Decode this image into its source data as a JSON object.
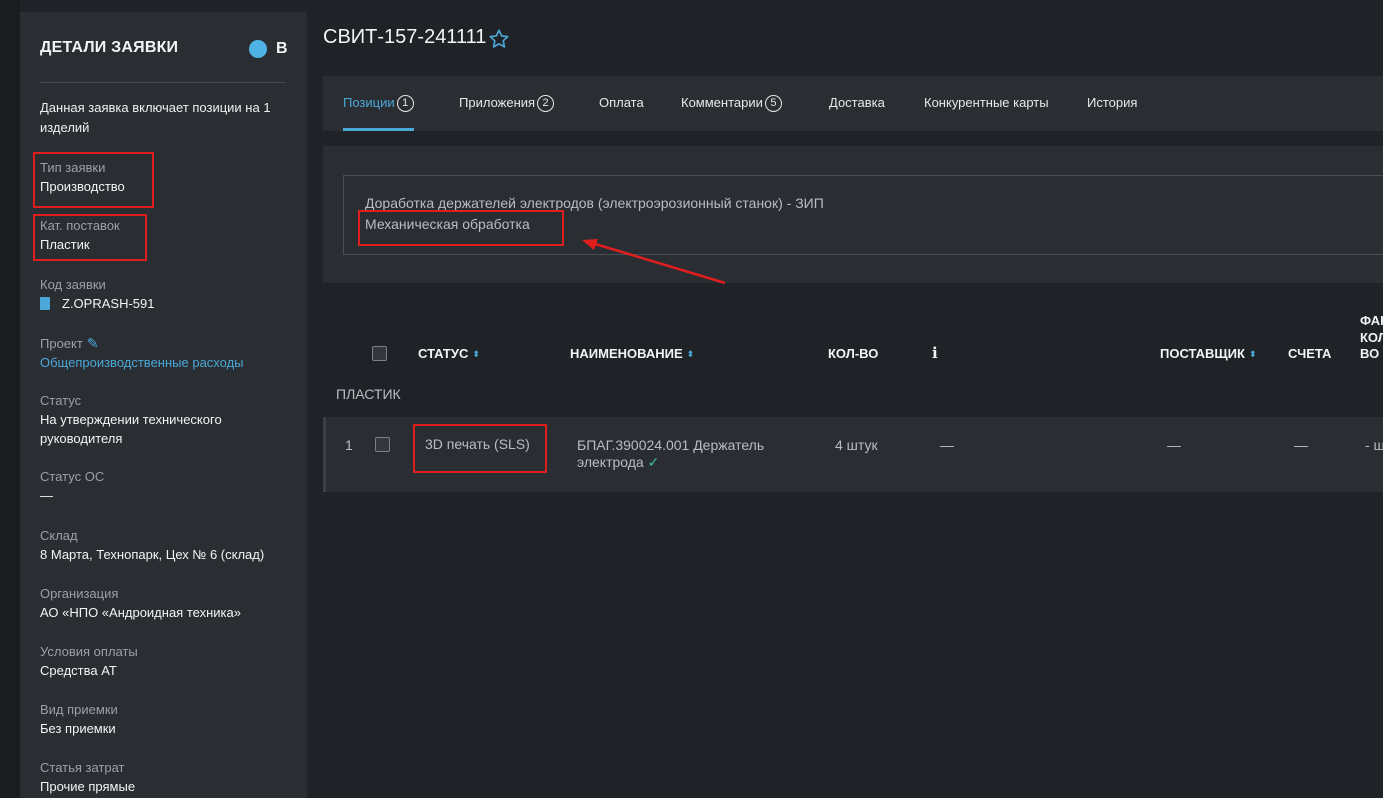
{
  "sidebar": {
    "title": "ДЕТАЛИ ЗАЯВКИ",
    "status_letter": "В",
    "intro": "Данная заявка включает позиции на 1 изделий",
    "fields": [
      {
        "label": "Тип заявки",
        "value": "Производство"
      },
      {
        "label": "Кат. поставок",
        "value": "Пластик"
      },
      {
        "label": "Код заявки",
        "value": "Z.OPRASH-591"
      },
      {
        "label": "Проект",
        "value": "Общепроизводственные расходы"
      },
      {
        "label": "Статус",
        "value": "На утверждении технического руководителя"
      },
      {
        "label": "Статус ОС",
        "value": "—"
      },
      {
        "label": "Склад",
        "value": "8 Марта, Технопарк, Цех № 6 (склад)"
      },
      {
        "label": "Организация",
        "value": "АО «НПО «Андроидная техника»"
      },
      {
        "label": "Условия оплаты",
        "value": "Средства АТ"
      },
      {
        "label": "Вид приемки",
        "value": "Без приемки"
      },
      {
        "label": "Статья затрат",
        "value": "Прочие прямые"
      }
    ],
    "accent_color": "#4fb3e6"
  },
  "header": {
    "title": "СВИТ-157-241111"
  },
  "tabs": [
    {
      "label": "Позиции",
      "badge": "1",
      "active": true
    },
    {
      "label": "Приложения",
      "badge": "2"
    },
    {
      "label": "Оплата",
      "badge": ""
    },
    {
      "label": "Комментарии",
      "badge": "5"
    },
    {
      "label": "Доставка",
      "badge": ""
    },
    {
      "label": "Конкурентные карты",
      "badge": ""
    },
    {
      "label": "История",
      "badge": ""
    }
  ],
  "description": {
    "line1": "Доработка держателей электродов (электроэрозионный станок) - ЗИП",
    "line2": "Механическая обработка"
  },
  "table": {
    "headers": {
      "status": "СТАТУС",
      "name": "НАИМЕНОВАНИЕ",
      "qty": "КОЛ-ВО",
      "info": "i",
      "supplier": "ПОСТАВЩИК",
      "invoices": "СЧЕТА",
      "fact": "ФАК",
      "fact_qty": "КОЛ",
      "fact_suffix": "ВО"
    },
    "group": "ПЛАСТИК",
    "rows": [
      {
        "num": "1",
        "status": "3D печать (SLS)",
        "name_line1": "БПАГ.390024.001 Держатель",
        "name_line2": "электрода",
        "qty": "4 штук",
        "info": "—",
        "supplier": "—",
        "invoices": "—",
        "fact": "- ш"
      }
    ]
  },
  "annotation_color": "#e01e1e"
}
